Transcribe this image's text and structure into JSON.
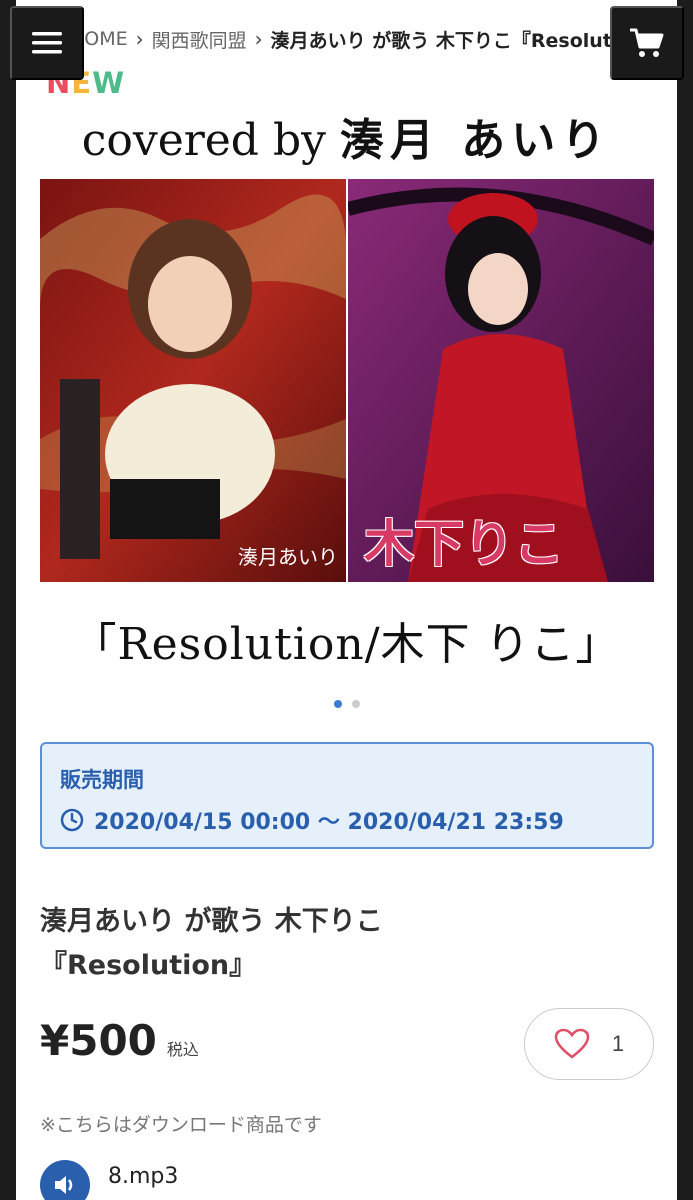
{
  "breadcrumb": {
    "home": "HOME",
    "category": "関西歌同盟",
    "current": "湊月あいり が歌う 木下りこ『Resolution』"
  },
  "badge": {
    "new_letters": [
      "N",
      "E",
      "W"
    ]
  },
  "cover": {
    "top_prefix": "covered by ",
    "top_name": "湊月 あいり",
    "left_caption": "湊月あいり",
    "right_caption": "木下りこ",
    "bottom": "「Resolution/木下 りこ」"
  },
  "carousel": {
    "total": 2,
    "active_index": 0
  },
  "sale": {
    "title": "販売期間",
    "period": "2020/04/15 00:00 〜 2020/04/21 23:59"
  },
  "product": {
    "title": "湊月あいり が歌う 木下りこ\n『Resolution』",
    "price": "¥500",
    "tax_label": "税込",
    "like_count": "1",
    "notice": "※こちらはダウンロード商品です",
    "file_name": "8.mp3"
  },
  "icons": {
    "menu": "hamburger-icon",
    "cart": "cart-icon",
    "clock": "clock-icon",
    "heart": "heart-icon",
    "audio": "speaker-icon"
  },
  "colors": {
    "accent": "#2a5fad",
    "sale_bg": "#e6f0fb",
    "heart": "#e0506a",
    "dark_button": "#1a1a1a"
  }
}
